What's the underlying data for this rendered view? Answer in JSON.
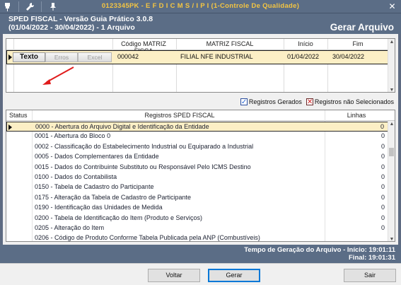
{
  "window": {
    "title": "0123345PK - E F D  I C M S / I P I (1-Controle De Qualidade)",
    "toolbar_icons": [
      "disconnect-plug-icon",
      "wrench-icon",
      "pin-icon"
    ],
    "close_label": "✕"
  },
  "header": {
    "app_title": "SPED FISCAL - Versão Guia Prático 3.0.8",
    "period": "(01/04/2022 - 30/04/2022) - 1 Arquivo",
    "screen_title": "Gerar Arquivo"
  },
  "files_grid": {
    "columns": [
      "Código MATRIZ FISCA",
      "MATRIZ FISCAL",
      "Início",
      "Fim"
    ],
    "row": {
      "buttons": [
        "Texto",
        "Erros",
        "Excel"
      ],
      "codigo": "000042",
      "matriz": "FILIAL NFE INDUSTRIAL",
      "inicio": "01/04/2022",
      "fim": "30/04/2022"
    }
  },
  "filters": {
    "registros_gerados": "Registros Gerados",
    "registros_nao_selecionados": "Registros não Selecionados"
  },
  "registros_grid": {
    "columns": [
      "Status",
      "Registros SPED FISCAL",
      "Linhas"
    ],
    "rows": [
      {
        "desc": "0000 - Abertura do Arquivo Digital e Identificação da Entidade",
        "linhas": "0"
      },
      {
        "desc": "0001 - Abertura do Bloco 0",
        "linhas": "0"
      },
      {
        "desc": "0002 - Classificação do Estabelecimento Industrial ou Equiparado a Industrial",
        "linhas": "0"
      },
      {
        "desc": "0005 - Dados Complementares da Entidade",
        "linhas": "0"
      },
      {
        "desc": "0015 - Dados do Contribuinte Substituto ou Responsável Pelo ICMS Destino",
        "linhas": "0"
      },
      {
        "desc": "0100 - Dados do Contabilista",
        "linhas": "0"
      },
      {
        "desc": "0150 - Tabela de Cadastro do Participante",
        "linhas": "0"
      },
      {
        "desc": "0175 - Alteração da Tabela de Cadastro de Participante",
        "linhas": "0"
      },
      {
        "desc": "0190 - Identificação das Unidades de Medida",
        "linhas": "0"
      },
      {
        "desc": "0200 - Tabela de Identificação do Item (Produto e Serviços)",
        "linhas": "0"
      },
      {
        "desc": "0205 - Alteração do Item",
        "linhas": "0"
      },
      {
        "desc": "0206 - Código de Produto Conforme Tabela Publicada pela ANP (Combustíveis)",
        "linhas": ""
      }
    ]
  },
  "status": {
    "inicio": "Tempo de Geração do Arquivo - Início: 19:01:11",
    "final": "Final: 19:01:31"
  },
  "buttons": {
    "voltar": "Voltar",
    "gerar": "Gerar",
    "sair": "Sair"
  }
}
